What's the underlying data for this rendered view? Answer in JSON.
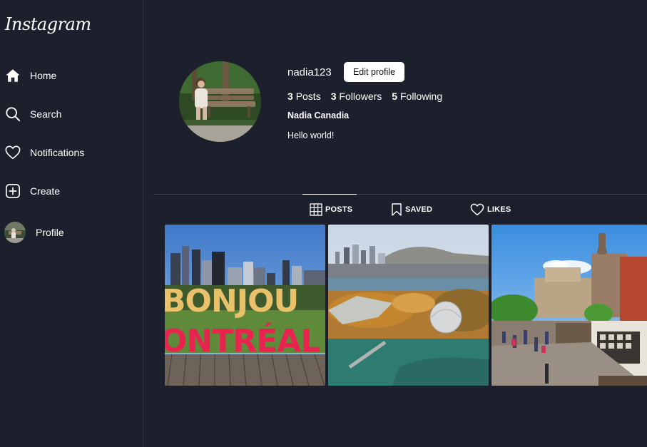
{
  "app": {
    "logo_text": "Instagram"
  },
  "sidebar": {
    "items": [
      {
        "label": "Home",
        "icon": "home-icon"
      },
      {
        "label": "Search",
        "icon": "search-icon"
      },
      {
        "label": "Notifications",
        "icon": "heart-icon"
      },
      {
        "label": "Create",
        "icon": "plus-square-icon"
      },
      {
        "label": "Profile",
        "icon": "avatar"
      }
    ]
  },
  "profile": {
    "username": "nadia123",
    "edit_label": "Edit profile",
    "stats": {
      "posts_count": "3",
      "posts_label": "Posts",
      "followers_count": "3",
      "followers_label": "Followers",
      "following_count": "5",
      "following_label": "Following"
    },
    "full_name": "Nadia Canadia",
    "bio": "Hello world!"
  },
  "tabs": [
    {
      "label": "POSTS",
      "icon": "grid-icon",
      "active": true
    },
    {
      "label": "SAVED",
      "icon": "bookmark-icon",
      "active": false
    },
    {
      "label": "LIKES",
      "icon": "heart-icon",
      "active": false
    }
  ],
  "posts": [
    {
      "sign_line1": "BONJOU",
      "sign_line2": "ONTRÉAL"
    },
    {
      "subject": "city-aerial"
    },
    {
      "subject": "street-market"
    }
  ],
  "colors": {
    "background": "#1b202c",
    "border": "#2f3544",
    "text": "#ffffff",
    "button_bg": "#ffffff",
    "button_text": "#111111",
    "sign_gold": "#e8c16a",
    "sign_red": "#e8234f"
  }
}
